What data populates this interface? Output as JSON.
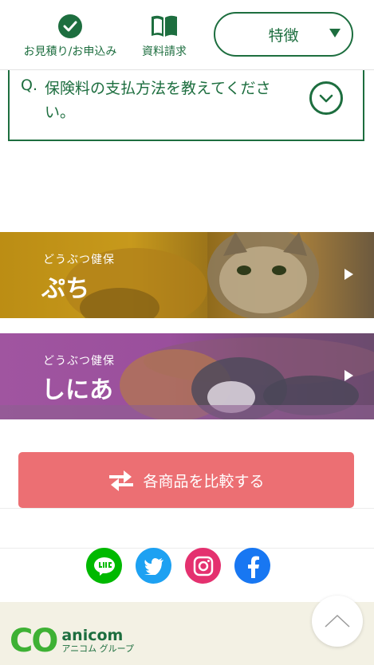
{
  "header": {
    "quote_label": "お見積り/お申込み",
    "docs_label": "資料請求",
    "features_label": "特徴"
  },
  "faq": {
    "q_prefix": "Q.",
    "question": "保険料の支払方法を教えてください。"
  },
  "banners": [
    {
      "small": "どうぶつ健保",
      "title": "ぷち"
    },
    {
      "small": "どうぶつ健保",
      "title": "しにあ"
    }
  ],
  "compare": {
    "label": "各商品を比較する"
  },
  "social": [
    "LINE",
    "Twitter",
    "Instagram",
    "Facebook"
  ],
  "footer": {
    "logo_co": "CO",
    "logo_brand": "anicom",
    "logo_sub": "アニコム グループ"
  },
  "colors": {
    "brand_green": "#1d6e3f",
    "compare_red": "#ec6f73",
    "line_green": "#00b900",
    "twitter_blue": "#1da1f2",
    "instagram_pink": "#e4316f",
    "facebook_blue": "#1877f2",
    "footer_bg": "#f3f1e4"
  },
  "icons": [
    "check-icon",
    "book-icon",
    "chevron-down-icon",
    "caret-down-icon",
    "play-icon",
    "swap-arrows-icon",
    "line-icon",
    "twitter-icon",
    "instagram-icon",
    "facebook-icon",
    "chevron-up-icon"
  ]
}
